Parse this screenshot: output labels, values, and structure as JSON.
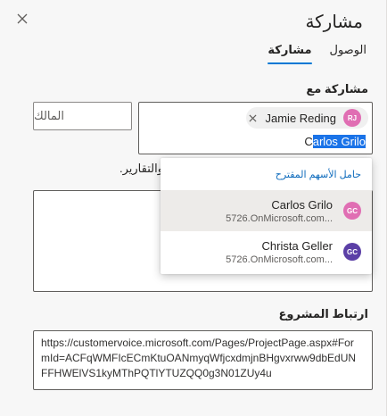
{
  "header": {
    "title": "مشاركة"
  },
  "tabs": [
    {
      "label": "مشاركة",
      "active": true
    },
    {
      "label": "الوصول",
      "active": false
    }
  ],
  "share_with": {
    "label": "مشاركة مع",
    "chip": {
      "initials": "RJ",
      "name": "Jamie Reding",
      "avatar_color": "#e06eb3"
    },
    "typed_prefix": "C",
    "typed_selected": "arlos Grilo",
    "role_placeholder": "المالك"
  },
  "hint_text": "والتقارير.",
  "suggestions": {
    "header": "حامل الأسهم المقترح",
    "items": [
      {
        "initials": "GC",
        "name": "Carlos Grilo",
        "sub": "5726.OnMicrosoft.com...",
        "avatar_color": "#e06eb3",
        "hovered": true
      },
      {
        "initials": "GC",
        "name": "Christa Geller",
        "sub": "5726.OnMicrosoft.com...",
        "avatar_color": "#5b3fa6",
        "hovered": false
      }
    ]
  },
  "project_link": {
    "label": "ارتباط المشروع",
    "lines": [
      "https://customervoice.microsoft.com/Pages/ProjectPage.aspx#For",
      "mId=ACFqWMFIcECmKtuOANmyqWfjcxdmjnBHgvxrww9dbEdUN",
      "FFHWElVS1kyMThPQTlYTUZQQ0g3N01ZUy4u"
    ]
  },
  "colors": {
    "accent": "#0078d4",
    "link": "#0f6cbd"
  },
  "icons": {
    "close": "close-icon",
    "remove_chip": "close-icon"
  }
}
